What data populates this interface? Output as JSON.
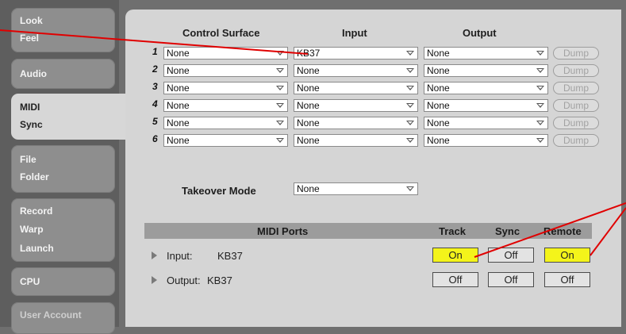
{
  "sidebar": {
    "tabs": [
      {
        "lines": [
          "Look",
          "Feel"
        ]
      },
      {
        "lines": [
          "Audio"
        ]
      },
      {
        "lines": [
          "MIDI",
          "Sync"
        ]
      },
      {
        "lines": [
          "File",
          "Folder"
        ]
      },
      {
        "lines": [
          "Record",
          "Warp",
          "Launch"
        ]
      },
      {
        "lines": [
          "CPU"
        ]
      },
      {
        "lines": [
          "User Account"
        ]
      }
    ]
  },
  "midi": {
    "headers": {
      "control_surface": "Control Surface",
      "input": "Input",
      "output": "Output"
    },
    "rows": [
      {
        "num": "1",
        "surface": "None",
        "input": "KB37",
        "output": "None",
        "dump": "Dump"
      },
      {
        "num": "2",
        "surface": "None",
        "input": "None",
        "output": "None",
        "dump": "Dump"
      },
      {
        "num": "3",
        "surface": "None",
        "input": "None",
        "output": "None",
        "dump": "Dump"
      },
      {
        "num": "4",
        "surface": "None",
        "input": "None",
        "output": "None",
        "dump": "Dump"
      },
      {
        "num": "5",
        "surface": "None",
        "input": "None",
        "output": "None",
        "dump": "Dump"
      },
      {
        "num": "6",
        "surface": "None",
        "input": "None",
        "output": "None",
        "dump": "Dump"
      }
    ],
    "takeover": {
      "label": "Takeover Mode",
      "value": "None"
    }
  },
  "ports": {
    "header": {
      "title": "MIDI Ports",
      "track": "Track",
      "sync": "Sync",
      "remote": "Remote"
    },
    "rows": [
      {
        "kind": "Input:",
        "name": "KB37",
        "track": "On",
        "sync": "Off",
        "remote": "On"
      },
      {
        "kind": "Output:",
        "name": "KB37",
        "track": "Off",
        "sync": "Off",
        "remote": "Off"
      }
    ]
  },
  "colors": {
    "on_button": "#f4f41a",
    "annotation_line": "#e00000"
  }
}
